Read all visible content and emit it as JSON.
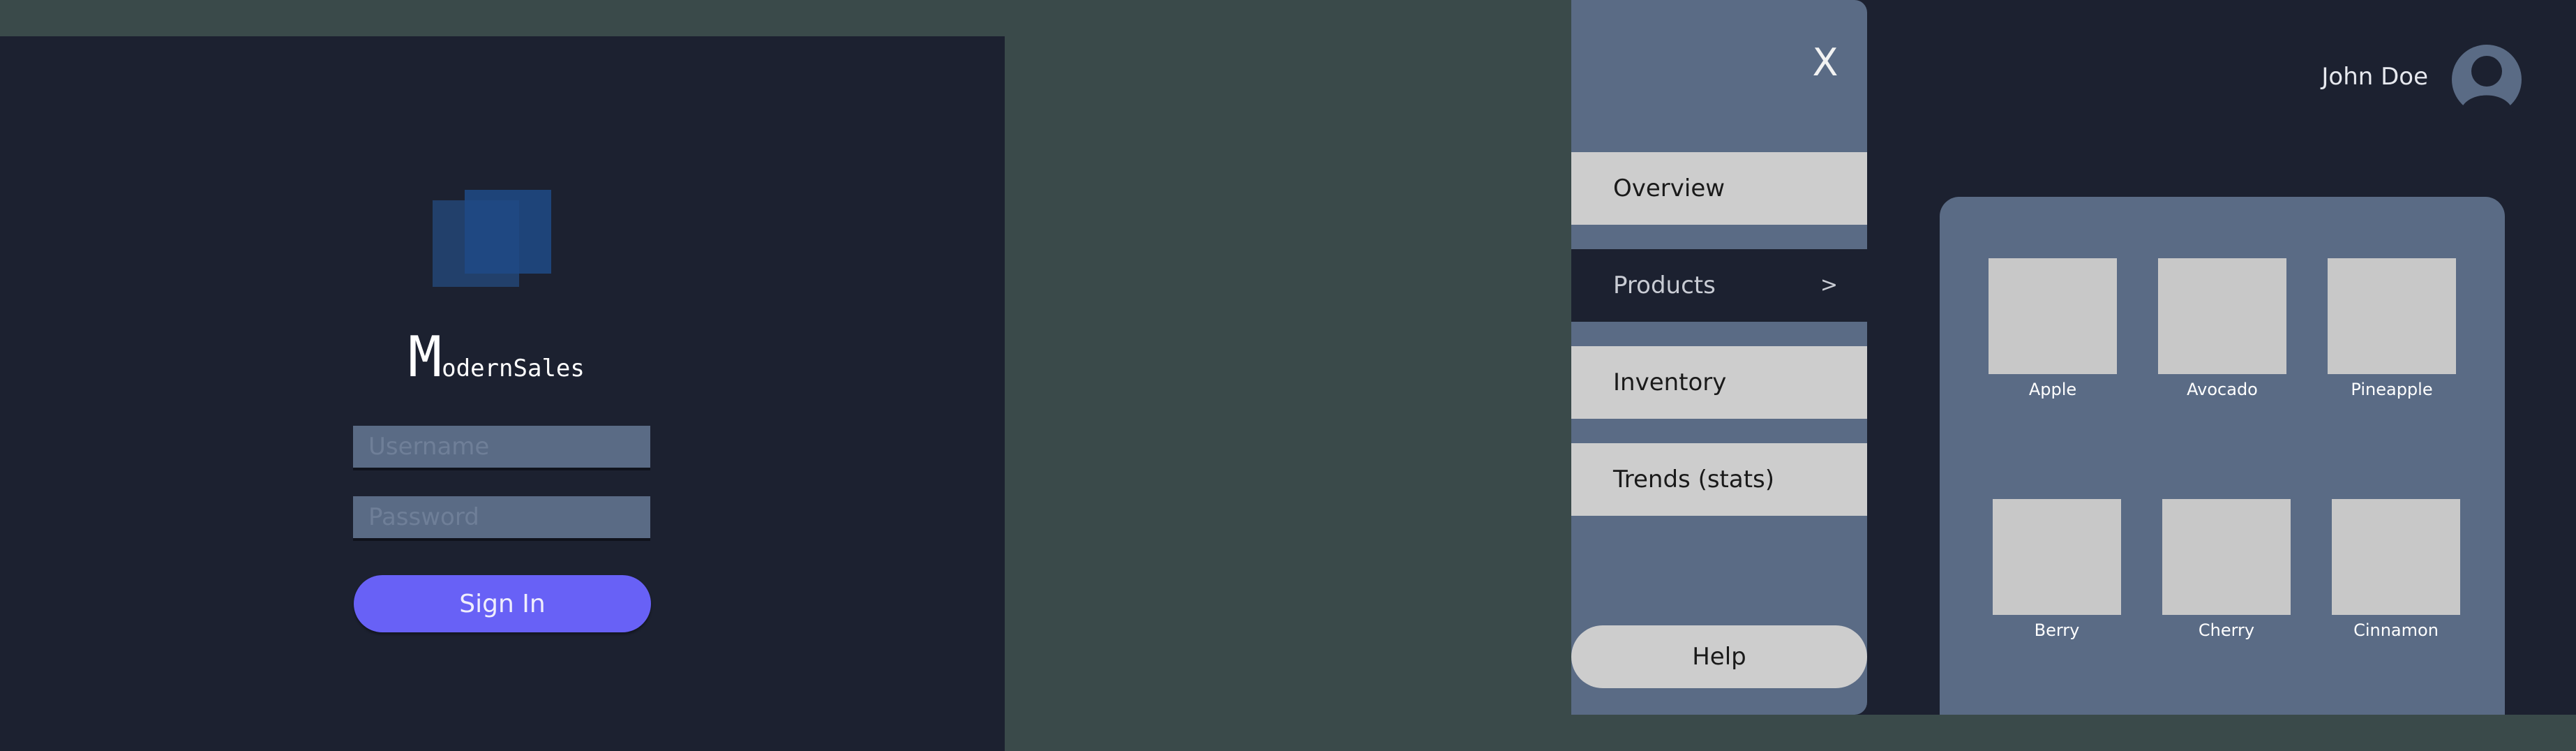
{
  "login": {
    "brand_initial": "M",
    "brand_rest": "odernSales",
    "username_placeholder": "Username",
    "password_placeholder": "Password",
    "signin_label": "Sign In",
    "colors": {
      "panel": "#1c2130",
      "accent": "#6861f6",
      "field": "#5a6b85"
    }
  },
  "dashboard": {
    "user_name": "John Doe",
    "close_symbol": "X",
    "nav": [
      {
        "label": "Overview",
        "active": false
      },
      {
        "label": "Products",
        "active": true,
        "chevron": ">"
      },
      {
        "label": "Inventory",
        "active": false
      },
      {
        "label": "Trends (stats)",
        "active": false
      }
    ],
    "help_label": "Help",
    "products": [
      "Apple",
      "Avocado",
      "Pineapple",
      "Berry",
      "Cherry",
      "Cinnamon"
    ],
    "icons": {
      "close": "close-icon",
      "avatar": "user-avatar-icon",
      "chevron": "chevron-right-icon"
    }
  }
}
